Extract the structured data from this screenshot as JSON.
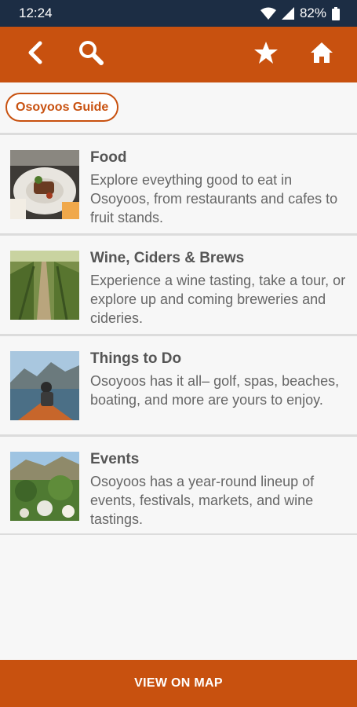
{
  "status_bar": {
    "time": "12:24",
    "battery": "82%",
    "icons": [
      "wifi-icon",
      "signal-icon",
      "battery-icon"
    ]
  },
  "app_bar": {
    "icons": [
      "back-icon",
      "search-icon",
      "star-icon",
      "home-icon"
    ]
  },
  "breadcrumb": {
    "label": "Osoyoos Guide"
  },
  "items": [
    {
      "title": "Food",
      "description": "Explore eveything good to eat in Osoyoos, from restaurants and cafes to fruit stands."
    },
    {
      "title": "Wine, Ciders & Brews",
      "description": "Experience a wine tasting, take a tour, or explore up and coming breweries and cideries."
    },
    {
      "title": "Things to Do",
      "description": "Osoyoos has it all– golf, spas, beaches, boating, and more are yours to enjoy."
    },
    {
      "title": "Events",
      "description": "Osoyoos has a year-round lineup of events, festivals, markets, and wine tastings."
    }
  ],
  "bottom": {
    "label": "VIEW ON MAP"
  },
  "colors": {
    "accent": "#c8510f",
    "status_bar": "#1c2d44",
    "background": "#f7f7f7"
  }
}
